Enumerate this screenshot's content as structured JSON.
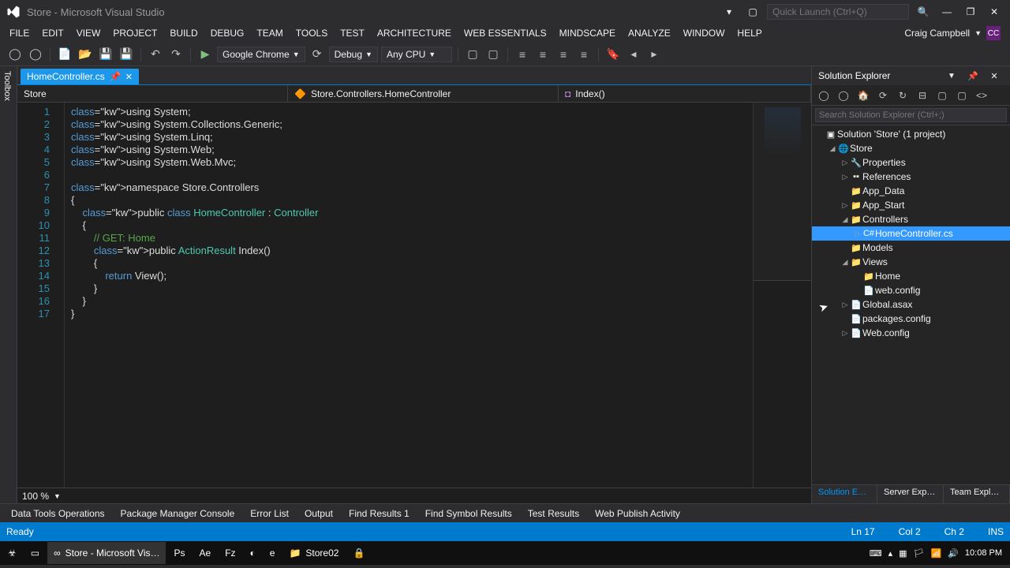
{
  "window": {
    "title": "Store - Microsoft Visual Studio",
    "quick_launch_ph": "Quick Launch (Ctrl+Q)"
  },
  "menu": [
    "FILE",
    "EDIT",
    "VIEW",
    "PROJECT",
    "BUILD",
    "DEBUG",
    "TEAM",
    "TOOLS",
    "TEST",
    "ARCHITECTURE",
    "WEB ESSENTIALS",
    "MINDSCAPE",
    "ANALYZE",
    "WINDOW",
    "HELP"
  ],
  "account": {
    "name": "Craig Campbell",
    "initials": "CC"
  },
  "toolbar": {
    "browser": "Google Chrome",
    "config": "Debug",
    "platform": "Any CPU"
  },
  "tabs": {
    "active": "HomeController.cs"
  },
  "nav": {
    "left": "Store",
    "mid": "Store.Controllers.HomeController",
    "right": "Index()"
  },
  "code_lines": [
    "using System;",
    "using System.Collections.Generic;",
    "using System.Linq;",
    "using System.Web;",
    "using System.Web.Mvc;",
    "",
    "namespace Store.Controllers",
    "{",
    "    public class HomeController : Controller",
    "    {",
    "        // GET: Home",
    "        public ActionResult Index()",
    "        {",
    "            return View();",
    "        }",
    "    }",
    "}"
  ],
  "zoom": "100 %",
  "solution": {
    "title": "Solution Explorer",
    "search_ph": "Search Solution Explorer (Ctrl+;)",
    "root": "Solution 'Store' (1 project)",
    "project": "Store",
    "items": [
      {
        "indent": 2,
        "arrow": "▷",
        "icon": "🔧",
        "label": "Properties"
      },
      {
        "indent": 2,
        "arrow": "▷",
        "icon": "▪▪",
        "label": "References"
      },
      {
        "indent": 2,
        "arrow": "",
        "icon": "📁",
        "label": "App_Data"
      },
      {
        "indent": 2,
        "arrow": "▷",
        "icon": "📁",
        "label": "App_Start"
      },
      {
        "indent": 2,
        "arrow": "◢",
        "icon": "📁",
        "label": "Controllers"
      },
      {
        "indent": 3,
        "arrow": "▷",
        "icon": "C#",
        "label": "HomeController.cs",
        "sel": true
      },
      {
        "indent": 2,
        "arrow": "",
        "icon": "📁",
        "label": "Models"
      },
      {
        "indent": 2,
        "arrow": "◢",
        "icon": "📁",
        "label": "Views"
      },
      {
        "indent": 3,
        "arrow": "",
        "icon": "📁",
        "label": "Home"
      },
      {
        "indent": 3,
        "arrow": "",
        "icon": "📄",
        "label": "web.config"
      },
      {
        "indent": 2,
        "arrow": "▷",
        "icon": "📄",
        "label": "Global.asax"
      },
      {
        "indent": 2,
        "arrow": "",
        "icon": "📄",
        "label": "packages.config"
      },
      {
        "indent": 2,
        "arrow": "▷",
        "icon": "📄",
        "label": "Web.config"
      }
    ],
    "panel_tabs": [
      "Solution Ex…",
      "Server Explo…",
      "Team Explo…"
    ]
  },
  "bottom_tabs": [
    "Data Tools Operations",
    "Package Manager Console",
    "Error List",
    "Output",
    "Find Results 1",
    "Find Symbol Results",
    "Test Results",
    "Web Publish Activity"
  ],
  "status": {
    "ready": "Ready",
    "ln": "Ln 17",
    "col": "Col 2",
    "ch": "Ch 2",
    "ins": "INS"
  },
  "taskbar": {
    "items": [
      {
        "icon": "☣",
        "label": ""
      },
      {
        "icon": "▭",
        "label": ""
      },
      {
        "icon": "∞",
        "label": "Store - Microsoft Vis…",
        "active": true
      },
      {
        "icon": "Ps",
        "label": ""
      },
      {
        "icon": "Ae",
        "label": ""
      },
      {
        "icon": "Fz",
        "label": ""
      },
      {
        "icon": "◐",
        "label": ""
      },
      {
        "icon": "e",
        "label": ""
      },
      {
        "icon": "📁",
        "label": "Store02"
      },
      {
        "icon": "🔒",
        "label": ""
      }
    ],
    "time": "10:08 PM"
  },
  "toolbox": "Toolbox"
}
